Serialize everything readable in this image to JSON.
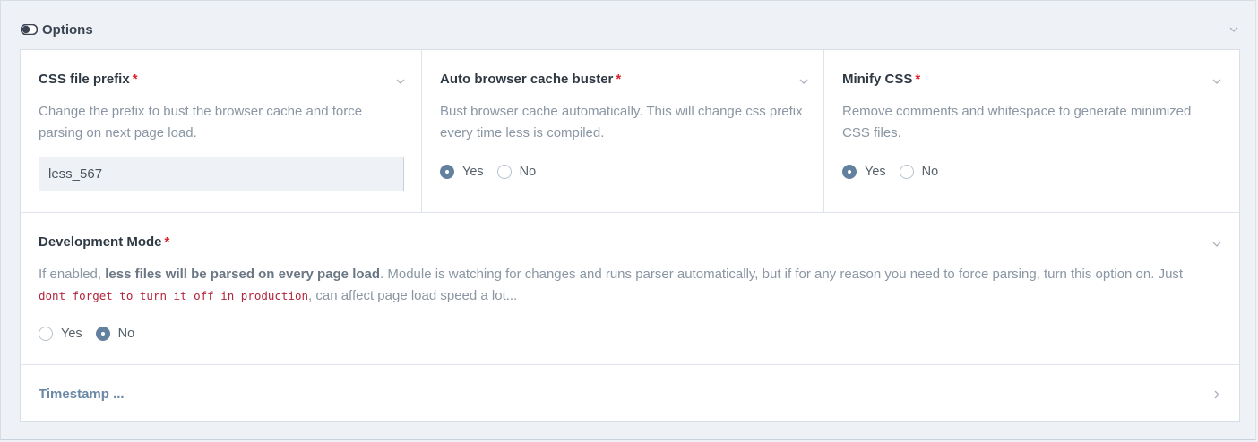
{
  "fieldset": {
    "title": "Options",
    "toggle_icon": "toggle-icon",
    "collapse_icon": "chevron-down-icon"
  },
  "fields": {
    "css_prefix": {
      "title": "CSS file prefix",
      "required_mark": "*",
      "description": "Change the prefix to bust the browser cache and force parsing on next page load.",
      "value": "less_567"
    },
    "cache_buster": {
      "title": "Auto browser cache buster",
      "required_mark": "*",
      "description": "Bust browser cache automatically. This will change css prefix every time less is compiled.",
      "options": [
        "Yes",
        "No"
      ],
      "selected": "Yes"
    },
    "minify": {
      "title": "Minify CSS",
      "required_mark": "*",
      "description": "Remove comments and whitespace to generate minimized CSS files.",
      "options": [
        "Yes",
        "No"
      ],
      "selected": "Yes"
    },
    "dev_mode": {
      "title": "Development Mode",
      "required_mark": "*",
      "desc_prefix": "If enabled, ",
      "desc_bold": "less files will be parsed on every page load",
      "desc_middle": ". Module is watching for changes and runs parser automatically, but if for any reason you need to force parsing, turn this option on. Just ",
      "desc_code": "dont forget to turn it off in production",
      "desc_suffix": ", can affect page load speed a lot...",
      "options": [
        "Yes",
        "No"
      ],
      "selected": "No"
    },
    "timestamp": {
      "label": "Timestamp ..."
    }
  },
  "colors": {
    "required": "#d9222a",
    "radio_checked": "#63809f",
    "link": "#6a87a6"
  }
}
